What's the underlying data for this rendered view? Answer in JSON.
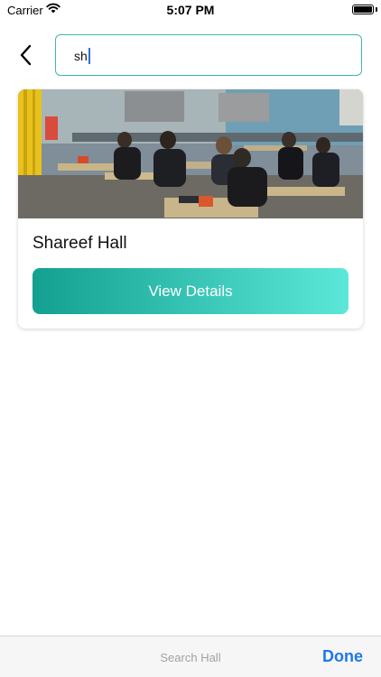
{
  "status_bar": {
    "carrier": "Carrier",
    "time": "5:07 PM",
    "wifi_icon": "wifi-icon",
    "battery_icon": "battery-icon"
  },
  "header": {
    "back_icon": "chevron-left-icon",
    "search_value": "sh",
    "accent_color": "#3db8a8"
  },
  "results": [
    {
      "image_icon": "classroom-photo",
      "title": "Shareef Hall",
      "button_label": "View Details"
    }
  ],
  "accessory_bar": {
    "placeholder": "Search Hall",
    "done_label": "Done"
  },
  "colors": {
    "gradient_start": "#14a090",
    "gradient_end": "#5ce8d8",
    "done_blue": "#1e78e6"
  }
}
